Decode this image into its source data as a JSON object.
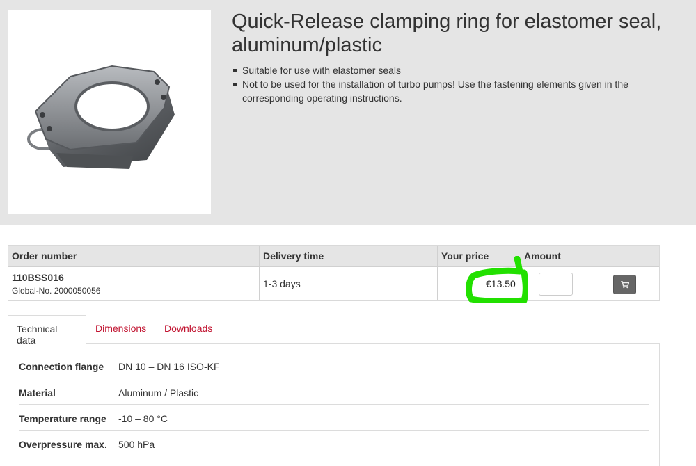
{
  "product": {
    "title": "Quick-Release clamping ring for elastomer seal, aluminum/plastic",
    "features": [
      "Suitable for use with elastomer seals",
      "Not to be used for the installation of turbo pumps! Use the fastening elements given in the corresponding operating instructions."
    ],
    "image_icon": "clamping-ring-photo"
  },
  "order_table": {
    "headers": {
      "order_number": "Order number",
      "delivery_time": "Delivery time",
      "your_price": "Your price",
      "amount": "Amount"
    },
    "row": {
      "order_number": "110BSS016",
      "global_no": "Global-No. 2000050056",
      "delivery_time": "1-3 days",
      "price": "€13.50",
      "amount": "",
      "cart_icon": "shopping-cart-icon"
    },
    "highlight_color": "#22e000"
  },
  "tabs": [
    {
      "label": "Technical data",
      "active": true
    },
    {
      "label": "Dimensions",
      "active": false
    },
    {
      "label": "Downloads",
      "active": false
    }
  ],
  "technical_data": [
    {
      "label": "Connection flange",
      "value": "DN 10 – DN 16 ISO-KF"
    },
    {
      "label": "Material",
      "value": "Aluminum / Plastic"
    },
    {
      "label": "Temperature range",
      "value": "-10 – 80 °C"
    },
    {
      "label": "Overpressure max.",
      "value": "500 hPa"
    }
  ],
  "colors": {
    "link": "#c1122f",
    "header_bg": "#e5e5e5",
    "cart_button": "#666666"
  }
}
